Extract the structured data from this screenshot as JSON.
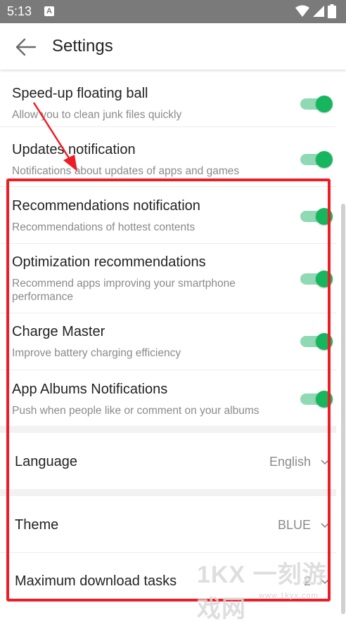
{
  "status_bar": {
    "time": "5:13",
    "app_icon_letter": "A"
  },
  "appbar": {
    "title": "Settings"
  },
  "toggles": [
    {
      "title": "Speed-up floating ball",
      "desc": "Allow you to clean junk files quickly",
      "on": true
    },
    {
      "title": "Updates notification",
      "desc": "Notifications about updates of apps and games",
      "on": true
    },
    {
      "title": "Recommendations notification",
      "desc": "Recommendations of hottest contents",
      "on": true
    },
    {
      "title": "Optimization recommendations",
      "desc": "Recommend apps improving your smartphone performance",
      "on": true
    },
    {
      "title": "Charge Master",
      "desc": "Improve battery charging efficiency",
      "on": true
    },
    {
      "title": "App Albums Notifications",
      "desc": "Push when people like or comment on your albums",
      "on": true
    }
  ],
  "selects": {
    "language": {
      "label": "Language",
      "value": "English"
    },
    "theme": {
      "label": "Theme",
      "value": "BLUE"
    },
    "max_download": {
      "label": "Maximum download tasks",
      "value": "2"
    }
  },
  "watermark": {
    "text": "1KX 一刻游戏网",
    "url": "www.1kyx.com"
  },
  "colors": {
    "status_bar": "#7a7a7a",
    "toggle_on_thumb": "#16b65e",
    "toggle_on_track": "#8fd9b4",
    "annotation_red": "#ee1c25"
  }
}
